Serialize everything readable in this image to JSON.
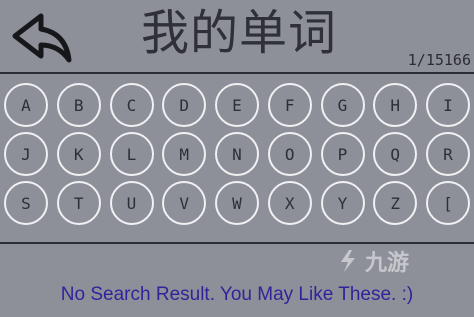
{
  "header": {
    "back_icon": "back-arrow-icon",
    "title": "我的单词",
    "counter": "1/15166"
  },
  "keyboard": {
    "rows": [
      [
        "A",
        "B",
        "C",
        "D",
        "E",
        "F",
        "G",
        "H",
        "I"
      ],
      [
        "J",
        "K",
        "L",
        "M",
        "N",
        "O",
        "P",
        "Q",
        "R"
      ],
      [
        "S",
        "T",
        "U",
        "V",
        "W",
        "X",
        "Y",
        "Z",
        "["
      ]
    ]
  },
  "watermark": {
    "text": "九游"
  },
  "search": {
    "message": "No Search Result. You May Like These. :)"
  },
  "colors": {
    "background": "#8e9099",
    "key_border": "#f1f1f3",
    "message_text": "#32239a",
    "title_text": "#2f3038"
  }
}
